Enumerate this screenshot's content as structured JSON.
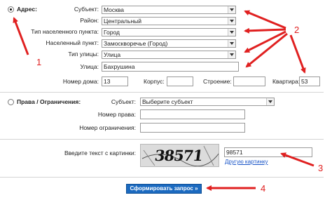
{
  "address": {
    "radio_label": "Адрес:",
    "subject_label": "Субъект:",
    "subject_value": "Москва",
    "district_label": "Район:",
    "district_value": "Центральный",
    "locality_type_label": "Тип населенного пункта:",
    "locality_type_value": "Город",
    "locality_label": "Населенный пункт:",
    "locality_value": "Замоскворечье (Город)",
    "street_type_label": "Тип улицы:",
    "street_type_value": "Улица",
    "street_label": "Улица:",
    "street_value": "Бахрушина",
    "house_label": "Номер дома:",
    "house_value": "13",
    "building_label": "Корпус:",
    "building_value": "",
    "structure_label": "Строение:",
    "structure_value": "",
    "apartment_label": "Квартира:",
    "apartment_value": "53"
  },
  "rights": {
    "radio_label": "Права / Ограничения:",
    "subject_label": "Субъект:",
    "subject_value": "Выберите субъект",
    "right_number_label": "Номер права:",
    "right_number_value": "",
    "restriction_number_label": "Номер ограничения:",
    "restriction_number_value": ""
  },
  "captcha": {
    "prompt": "Введите текст с картинки:",
    "image_text": "38571",
    "input_value": "98571",
    "refresh_link": "Другую картинку"
  },
  "submit": {
    "label": "Сформировать запрос »"
  },
  "annotations": [
    "1",
    "2",
    "3",
    "4"
  ],
  "colors": {
    "arrow": "#e02020",
    "button": "#1b6ac0",
    "link": "#1a55c8"
  }
}
